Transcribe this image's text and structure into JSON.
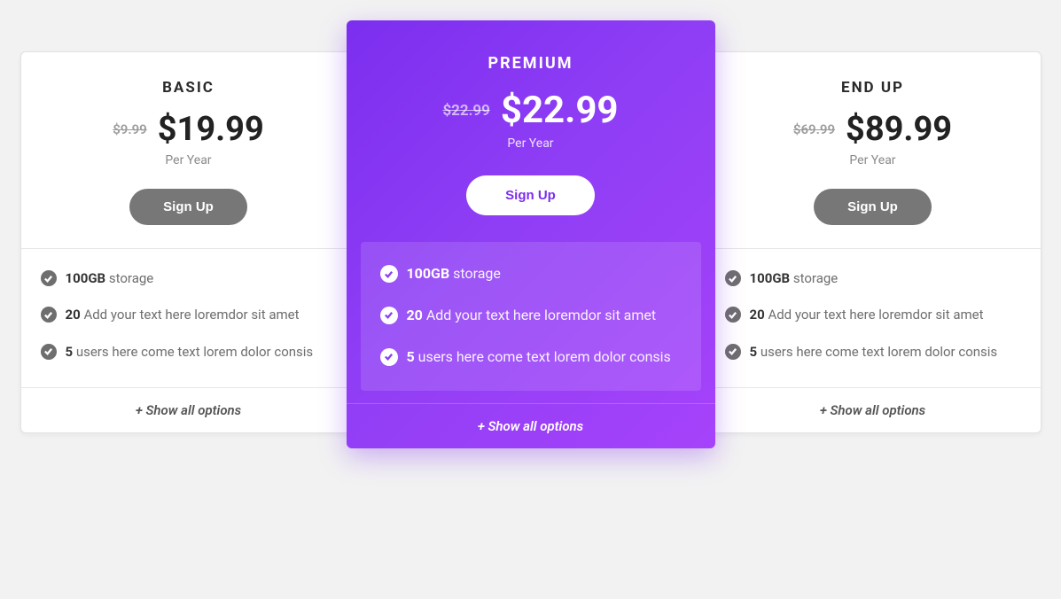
{
  "plans": [
    {
      "name": "BASIC",
      "old_price": "$9.99",
      "new_price": "$19.99",
      "period": "Per Year",
      "cta": "Sign Up",
      "features": [
        {
          "bold": "100GB",
          "rest": " storage"
        },
        {
          "bold": "20",
          "rest": " Add your text here loremdor sit amet"
        },
        {
          "bold": "5",
          "rest": " users here come text lorem dolor consis"
        }
      ],
      "show_all": "+ Show all options"
    },
    {
      "name": "PREMIUM",
      "old_price": "$22.99",
      "new_price": "$22.99",
      "period": "Per Year",
      "cta": "Sign Up",
      "features": [
        {
          "bold": "100GB",
          "rest": " storage"
        },
        {
          "bold": "20",
          "rest": " Add your text here loremdor sit amet"
        },
        {
          "bold": "5",
          "rest": " users here come text lorem dolor consis"
        }
      ],
      "show_all": "+ Show all options"
    },
    {
      "name": "END UP",
      "old_price": "$69.99",
      "new_price": "$89.99",
      "period": "Per Year",
      "cta": "Sign Up",
      "features": [
        {
          "bold": "100GB",
          "rest": " storage"
        },
        {
          "bold": "20",
          "rest": " Add your text here loremdor sit amet"
        },
        {
          "bold": "5",
          "rest": " users here come text lorem dolor consis"
        }
      ],
      "show_all": "+ Show all options"
    }
  ]
}
